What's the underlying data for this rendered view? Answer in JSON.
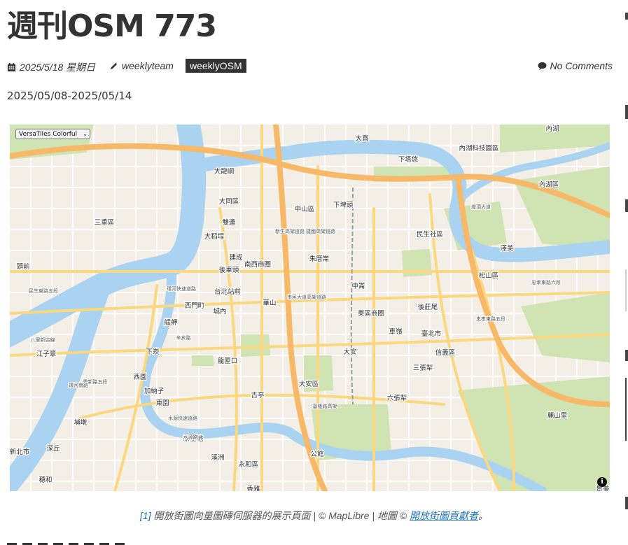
{
  "post": {
    "title": "週刊OSM 773",
    "date": "2025/5/18 星期日",
    "author": "weeklyteam",
    "tag": "weeklyOSM",
    "comments": "No Comments",
    "date_range": "2025/05/08-2025/05/14"
  },
  "map": {
    "style_select": "VersaTiles Colorful",
    "info_label": "i",
    "labels": [
      "大直",
      "內湖科技園區",
      "內湖",
      "下塔悠",
      "大龍峒",
      "中山區",
      "下埤頭",
      "大同區",
      "雙連",
      "內湖區",
      "三重區",
      "民生社區",
      "大稻埕",
      "澤美",
      "建成",
      "朱厝崙",
      "南西商圈",
      "後車頭",
      "頭前",
      "松山區",
      "台北站前",
      "中崙",
      "華山",
      "西門町",
      "後莊尾",
      "城內",
      "東區商圈",
      "艋舺",
      "車嶺",
      "臺北市",
      "江子翠",
      "下崁",
      "大安",
      "信義區",
      "龍匣口",
      "三張犁",
      "西園",
      "加納子",
      "大安區",
      "古亭",
      "東園",
      "六張犁",
      "埔墘",
      "新生地",
      "麗山里",
      "新北市",
      "深丘",
      "溪洲",
      "公館",
      "永和區",
      "穗和",
      "香雅",
      "景美"
    ],
    "road_labels": [
      "民生東路五段",
      "八里新店線",
      "忠孝東路六段",
      "忠孝東路五段",
      "市民大道高架道路",
      "基隆路高架",
      "環河快速道路",
      "堤頂大道",
      "建國高架道路",
      "新生高架道路",
      "辛亥路",
      "水源快速道路",
      "重新路五段",
      "水源路",
      "環河南路"
    ]
  },
  "caption": {
    "ref": "[1]",
    "text": " 開放街圖向量圖磚伺服器的展示頁面 | © MapLibre | 地圖 © ",
    "link": "開放街圖貢獻者",
    "end": "。"
  },
  "colors": {
    "text": "#333333",
    "tag_bg": "#333333",
    "link": "#1e73be",
    "water": "#a9d3f0",
    "land": "#f3efe6",
    "park": "#cfe3b3",
    "highway": "#f7b867",
    "road": "#fbd77f"
  }
}
